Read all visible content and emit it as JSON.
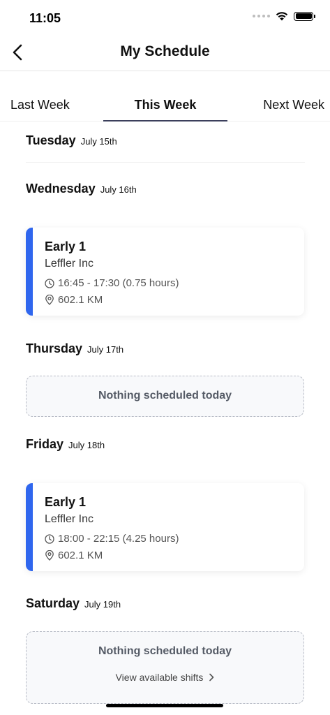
{
  "status_bar": {
    "time": "11:05"
  },
  "header": {
    "title": "My Schedule"
  },
  "tabs": [
    {
      "label": "Last Week",
      "active": false
    },
    {
      "label": "This Week",
      "active": true
    },
    {
      "label": "Next Week",
      "active": false
    }
  ],
  "days": [
    {
      "name": "Tuesday",
      "date": "July 15th"
    },
    {
      "name": "Wednesday",
      "date": "July 16th",
      "shift": {
        "title": "Early 1",
        "company": "Leffler Inc",
        "time": "16:45 - 17:30 (0.75 hours)",
        "distance": "602.1 KM"
      }
    },
    {
      "name": "Thursday",
      "date": "July 17th",
      "empty_text": "Nothing scheduled today"
    },
    {
      "name": "Friday",
      "date": "July 18th",
      "shift": {
        "title": "Early 1",
        "company": "Leffler Inc",
        "time": "18:00 - 22:15 (4.25 hours)",
        "distance": "602.1 KM"
      }
    },
    {
      "name": "Saturday",
      "date": "July 19th",
      "empty_text": "Nothing scheduled today",
      "link_label": "View available shifts"
    }
  ],
  "colors": {
    "accent": "#2f66ee",
    "tab_underline": "#3b3f5c"
  },
  "icons": [
    "back-chevron-icon",
    "clock-icon",
    "location-pin-icon",
    "chevron-right-icon",
    "wifi-icon",
    "battery-icon"
  ]
}
